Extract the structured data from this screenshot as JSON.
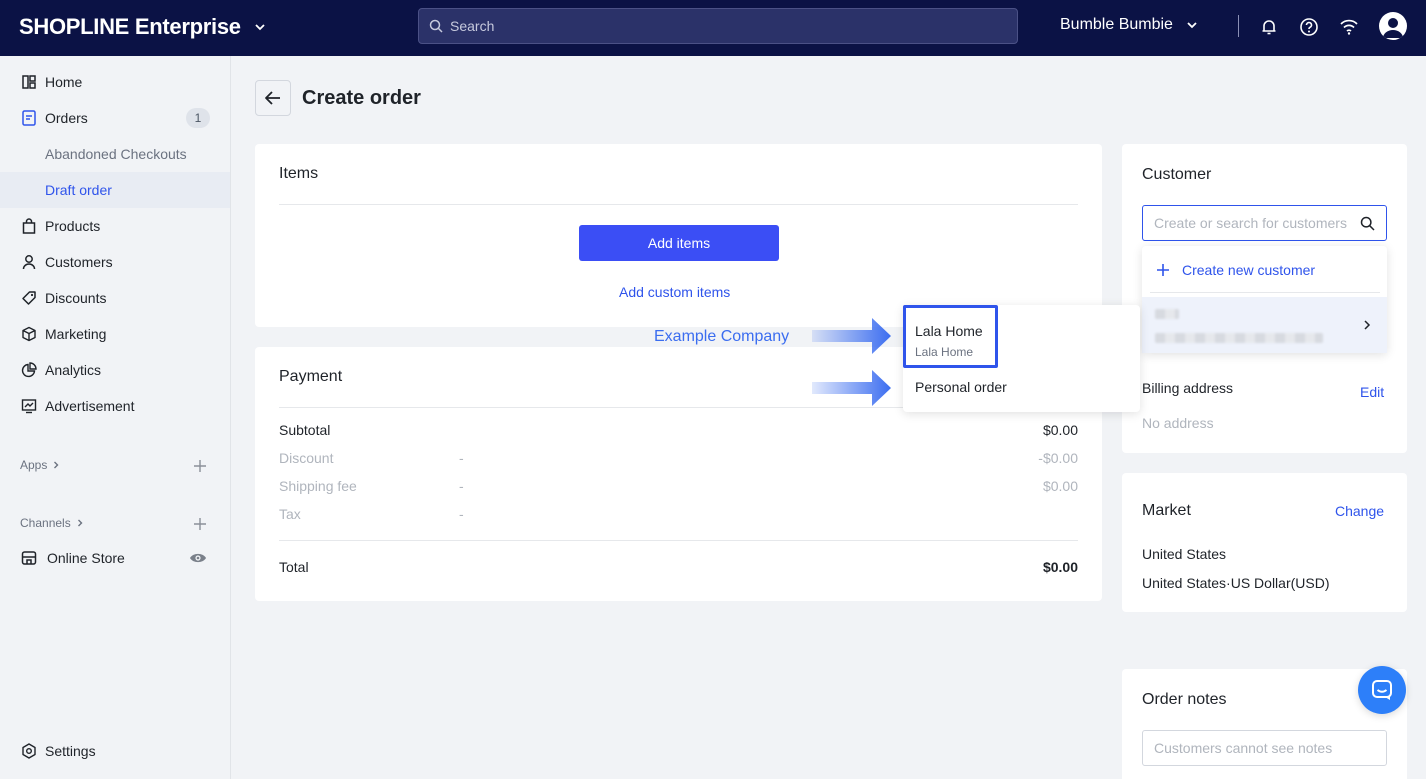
{
  "topbar": {
    "brand": "SHOPLINE Enterprise",
    "search_placeholder": "Search",
    "store_name": "Bumble Bumbie"
  },
  "sidebar": {
    "home": "Home",
    "orders": "Orders",
    "orders_badge": "1",
    "abandoned": "Abandoned Checkouts",
    "draft": "Draft order",
    "products": "Products",
    "customers": "Customers",
    "discounts": "Discounts",
    "marketing": "Marketing",
    "analytics": "Analytics",
    "advertisement": "Advertisement",
    "apps": "Apps",
    "channels": "Channels",
    "online_store": "Online Store",
    "settings": "Settings"
  },
  "page": {
    "title": "Create order"
  },
  "items_card": {
    "title": "Items",
    "add_items": "Add items",
    "add_custom": "Add custom items"
  },
  "payment": {
    "title": "Payment",
    "subtotal_label": "Subtotal",
    "subtotal_value": "$0.00",
    "discount_label": "Discount",
    "discount_dash": "-",
    "discount_value": "-$0.00",
    "shipping_label": "Shipping fee",
    "shipping_dash": "-",
    "shipping_value": "$0.00",
    "tax_label": "Tax",
    "tax_dash": "-",
    "total_label": "Total",
    "total_value": "$0.00"
  },
  "company_dropdown": {
    "company_name": "Lala Home",
    "company_sub": "Lala Home",
    "personal": "Personal order"
  },
  "annotation": {
    "example_company": "Example Company"
  },
  "customer": {
    "title": "Customer",
    "search_placeholder": "Create or search for customers",
    "create_new": "Create new customer",
    "billing_label": "Billing address",
    "billing_edit": "Edit",
    "billing_value": "No address"
  },
  "market": {
    "title": "Market",
    "change": "Change",
    "country": "United States",
    "currency": "United States·US Dollar(USD)"
  },
  "notes": {
    "title": "Order notes",
    "placeholder": "Customers cannot see notes"
  },
  "colors": {
    "topbar": "#0b1245",
    "primary": "#3b4ef5",
    "link": "#2f54eb",
    "annotation": "#3b6df0"
  }
}
